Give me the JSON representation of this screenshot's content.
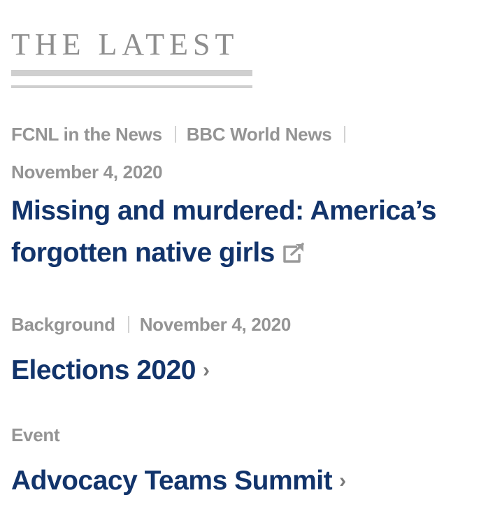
{
  "section": {
    "title": "THE LATEST"
  },
  "items": [
    {
      "category": "FCNL in the News",
      "source": "BBC World News",
      "date": "November 4, 2020",
      "headline": "Missing and murdered: America’s forgotten native girls",
      "icon": "external-link-icon"
    },
    {
      "category": "Background",
      "date": "November 4, 2020",
      "headline": "Elections 2020",
      "icon": "chevron-right-icon"
    },
    {
      "category": "Event",
      "headline": "Advocacy Teams Summit",
      "icon": "chevron-right-icon"
    }
  ],
  "colors": {
    "headline": "#12346b",
    "meta": "#949494",
    "rule": "#cfcfcf",
    "title": "#8e8e8e"
  }
}
